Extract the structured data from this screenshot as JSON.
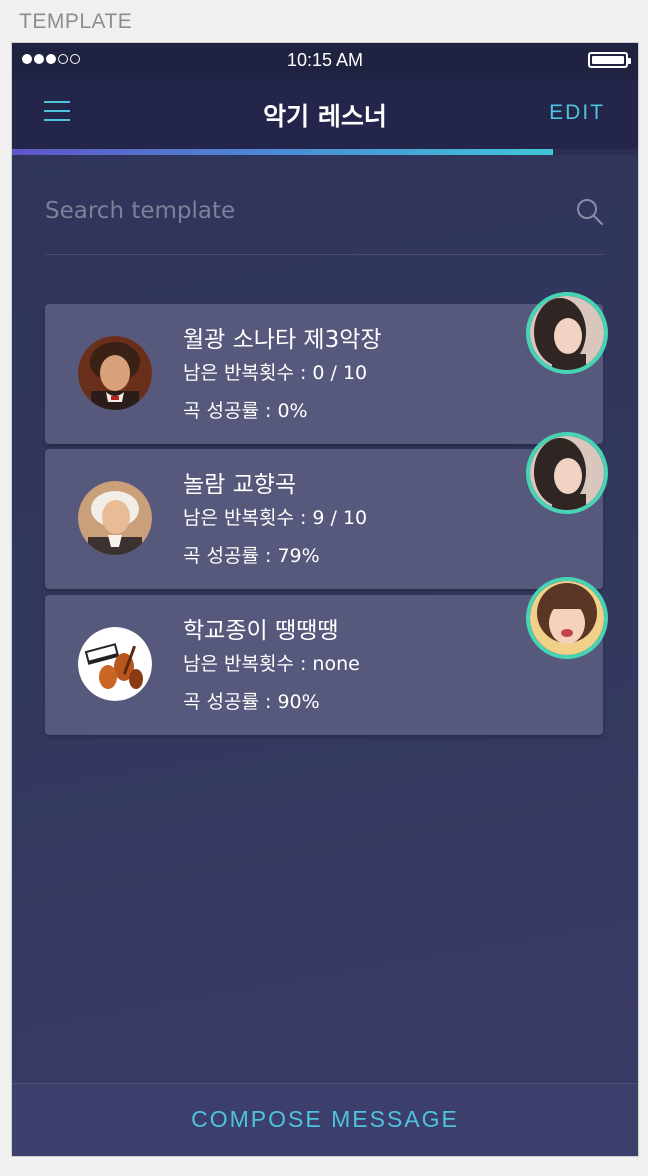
{
  "page_label": "TEMPLATE",
  "status_bar": {
    "signal_dots": [
      true,
      true,
      true,
      false,
      false
    ],
    "time": "10:15 AM"
  },
  "nav": {
    "menu_icon": "hamburger-icon",
    "title": "악기 레스너",
    "edit_label": "EDIT"
  },
  "progress": {
    "fraction": 0.865
  },
  "search": {
    "placeholder": "Search template",
    "icon": "search-icon"
  },
  "lessons": [
    {
      "title": "월광 소나타 제3악장",
      "repetitions": "남은 반복횟수 : 0 / 10",
      "success_rate": "곡 성공률 : 0%"
    },
    {
      "title": "놀람 교향곡",
      "repetitions": "남은 반복횟수 : 9 / 10",
      "success_rate": "곡 성공률 : 79%"
    },
    {
      "title": "학교종이 땡땡땡",
      "repetitions": "남은 반복횟수 : none",
      "success_rate": "곡 성공률 : 90%"
    }
  ],
  "compose": {
    "label": "COMPOSE MESSAGE"
  },
  "colors": {
    "accent": "#4fc3de",
    "avatar_ring": "#46d4b4",
    "card": "#56597c",
    "background": "#32375d"
  }
}
